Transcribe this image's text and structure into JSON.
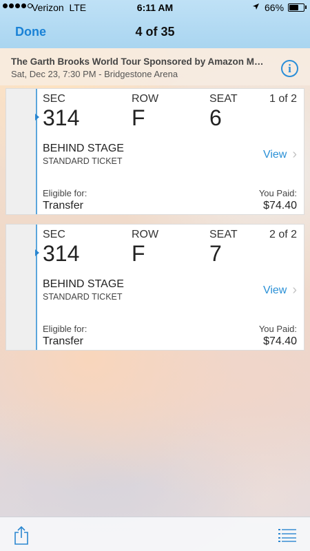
{
  "status_bar": {
    "carrier": "Verizon",
    "network": "LTE",
    "time": "6:11 AM",
    "battery": "66%",
    "battery_level": 0.66,
    "signal_bars": 4,
    "icons": [
      "signal-dots-icon",
      "location-arrow-icon",
      "battery-icon"
    ]
  },
  "nav": {
    "done_label": "Done",
    "title": "4 of 35"
  },
  "event": {
    "title": "The Garth Brooks World Tour Sponsored by Amazon Music Unlimited",
    "subtitle": "Sat, Dec 23, 7:30 PM - Bridgestone Arena",
    "info_icon": "info-icon"
  },
  "tickets": [
    {
      "sec_label": "SEC",
      "sec": "314",
      "row_label": "ROW",
      "row": "F",
      "seat_label": "SEAT",
      "seat": "6",
      "count": "1 of 2",
      "section_name": "BEHIND STAGE",
      "ticket_type": "STANDARD TICKET",
      "view_label": "View",
      "eligible_label": "Eligible for:",
      "eligible_value": "Transfer",
      "paid_label": "You Paid:",
      "paid_value": "$74.40"
    },
    {
      "sec_label": "SEC",
      "sec": "314",
      "row_label": "ROW",
      "row": "F",
      "seat_label": "SEAT",
      "seat": "7",
      "count": "2 of 2",
      "section_name": "BEHIND STAGE",
      "ticket_type": "STANDARD TICKET",
      "view_label": "View",
      "eligible_label": "Eligible for:",
      "eligible_value": "Transfer",
      "paid_label": "You Paid:",
      "paid_value": "$74.40"
    }
  ],
  "toolbar": {
    "icons": [
      "share-icon",
      "list-icon"
    ]
  },
  "colors": {
    "accent": "#1a82d6",
    "nav_bg": "#bfe1f6",
    "ticket_stub_line": "#5aa6dc"
  }
}
